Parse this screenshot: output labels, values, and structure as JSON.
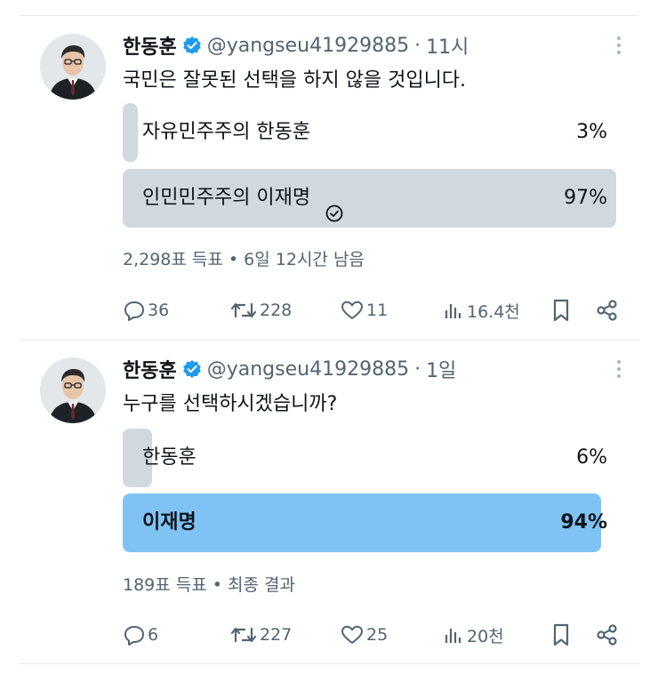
{
  "tweets": [
    {
      "name": "한동훈",
      "handle": "@yangseu41929885",
      "separator": "·",
      "time": "11시",
      "text": "국민은 잘못된 선택을 하지 않을 것입니다.",
      "poll": [
        {
          "label": "자유민주주의 한동훈",
          "pct": "3%",
          "fraction": 0.03,
          "selected": false
        },
        {
          "label": "인민민주주의 이재명",
          "pct": "97%",
          "fraction": 0.97,
          "selected": true
        }
      ],
      "meta": "2,298표 득표 • 6일 12시간 남음",
      "actions": {
        "replies": "36",
        "retweets": "228",
        "likes": "11",
        "views": "16.4천"
      }
    },
    {
      "name": "한동훈",
      "handle": "@yangseu41929885",
      "separator": "·",
      "time": "1일",
      "text": "누구를 선택하시겠습니까?",
      "poll": [
        {
          "label": "한동훈",
          "pct": "6%",
          "fraction": 0.06,
          "winner": false
        },
        {
          "label": "이재명",
          "pct": "94%",
          "fraction": 0.94,
          "winner": true
        }
      ],
      "meta": "189표 득표 • 최종 결과",
      "actions": {
        "replies": "6",
        "retweets": "227",
        "likes": "25",
        "views": "20천"
      }
    }
  ],
  "icons": {
    "verified": "verified-badge-icon",
    "check": "check-circle-icon",
    "reply": "reply-icon",
    "retweet": "retweet-icon",
    "like": "heart-icon",
    "views": "views-icon",
    "bookmark": "bookmark-icon",
    "share": "share-icon",
    "more": "more-icon"
  },
  "colors": {
    "verified": "#1d9bf0",
    "poll_bar": "#cfd9de",
    "poll_winner": "#7fc3f5",
    "secondary_text": "#536471"
  }
}
